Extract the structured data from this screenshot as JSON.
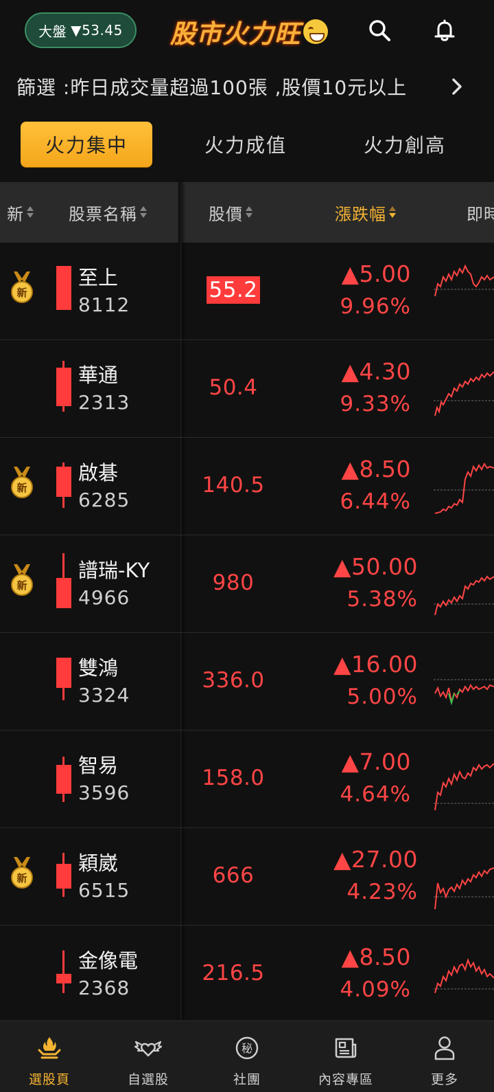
{
  "header": {
    "index_label": "大盤",
    "index_arrow": "▼",
    "index_value": "53.45",
    "brand": "股市火力旺",
    "icons": [
      "search-icon",
      "bell-icon"
    ]
  },
  "filter": {
    "text": "篩選 :昨日成交量超過100張 ,股價10元以上"
  },
  "tabs": [
    {
      "label": "火力集中",
      "active": true
    },
    {
      "label": "火力成值",
      "active": false
    },
    {
      "label": "火力創高",
      "active": false
    }
  ],
  "columns": {
    "new": "新",
    "name": "股票名稱",
    "price": "股價",
    "change": "漲跌幅",
    "chart": "即時"
  },
  "colors": {
    "accent": "#f5b332",
    "up": "#ff4545",
    "down": "#3fbf4c",
    "index_pill": "#1e4b3a"
  },
  "stocks": [
    {
      "new": true,
      "name": "至上",
      "code": "8112",
      "price": "55.2",
      "change": "▲5.00",
      "pct": "9.96%",
      "flash": true
    },
    {
      "new": false,
      "name": "華通",
      "code": "2313",
      "price": "50.4",
      "change": "▲4.30",
      "pct": "9.33%",
      "flash": false
    },
    {
      "new": true,
      "name": "啟碁",
      "code": "6285",
      "price": "140.5",
      "change": "▲8.50",
      "pct": "6.44%",
      "flash": false
    },
    {
      "new": true,
      "name": "譜瑞-KY",
      "code": "4966",
      "price": "980",
      "change": "▲50.00",
      "pct": "5.38%",
      "flash": false
    },
    {
      "new": false,
      "name": "雙鴻",
      "code": "3324",
      "price": "336.0",
      "change": "▲16.00",
      "pct": "5.00%",
      "flash": false
    },
    {
      "new": false,
      "name": "智易",
      "code": "3596",
      "price": "158.0",
      "change": "▲7.00",
      "pct": "4.64%",
      "flash": false
    },
    {
      "new": true,
      "name": "穎崴",
      "code": "6515",
      "price": "666",
      "change": "▲27.00",
      "pct": "4.23%",
      "flash": false
    },
    {
      "new": false,
      "name": "金像電",
      "code": "2368",
      "price": "216.5",
      "change": "▲8.50",
      "pct": "4.09%",
      "flash": false
    }
  ],
  "medal_text": "新",
  "bottom_nav": [
    {
      "label": "選股頁",
      "icon": "fire-hand-icon",
      "active": true
    },
    {
      "label": "自選股",
      "icon": "winged-heart-icon",
      "active": false
    },
    {
      "label": "社團",
      "icon": "secret-badge-icon",
      "glyph": "秘",
      "active": false
    },
    {
      "label": "內容專區",
      "icon": "newspaper-icon",
      "active": false
    },
    {
      "label": "更多",
      "icon": "person-icon",
      "active": false
    }
  ]
}
